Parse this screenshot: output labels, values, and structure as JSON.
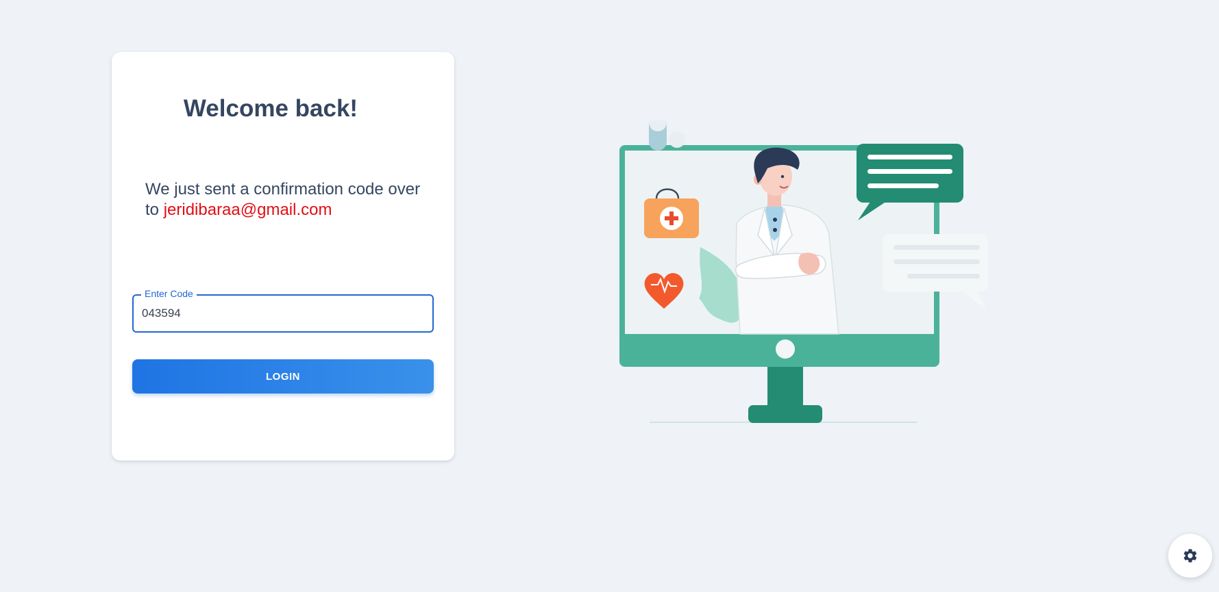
{
  "login": {
    "title": "Welcome back!",
    "message_prefix": "We just sent a confirmation code over to ",
    "email": "jeridibaraa@gmail.com",
    "code_field": {
      "label": "Enter Code",
      "value": "043594"
    },
    "login_button_label": "LOGIN"
  },
  "settings": {
    "icon": "gear-icon"
  },
  "illustration": {
    "icon": "telemedicine-doctor-illustration"
  },
  "colors": {
    "background": "#eff2f6",
    "heading": "#354661",
    "email": "#e10e16",
    "primary": "#2167d0",
    "illustration_green": "#4bb29a",
    "illustration_dark_green": "#238c73"
  }
}
